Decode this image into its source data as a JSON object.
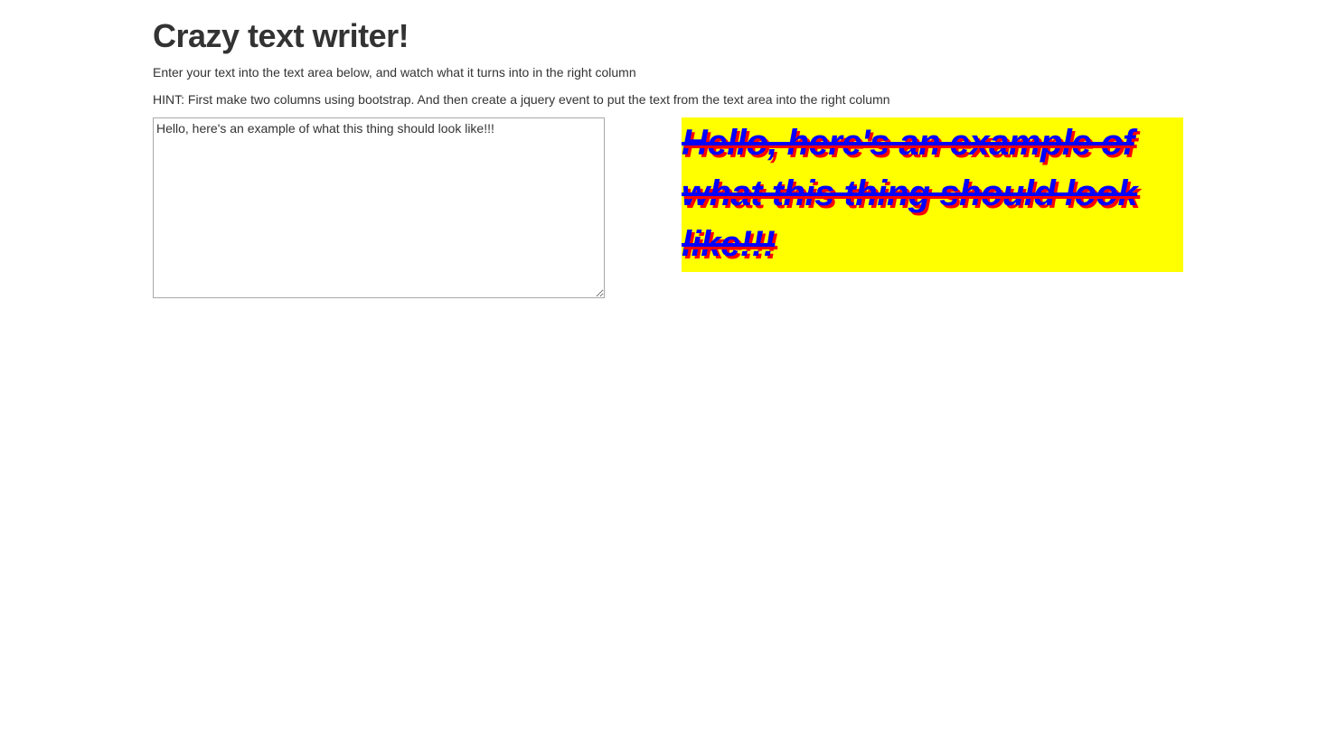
{
  "page": {
    "title": "Crazy text writer!",
    "intro": "Enter your text into the text area below, and watch what it turns into in the right column",
    "hint": "HINT: First make two columns using bootstrap. And then create a jquery event to put the text from the text area into the right column"
  },
  "editor": {
    "value": "Hello, here's an example of what this thing should look like!!!"
  },
  "output": {
    "text": "Hello, here's an example of what this thing should look like!!!",
    "background_color": "#ffff00",
    "text_color": "#0000ff",
    "shadow_color": "#ff0000"
  }
}
